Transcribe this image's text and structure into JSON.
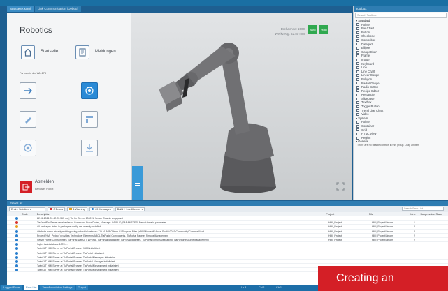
{
  "ide": {
    "doc_tabs": [
      "Startseite.xaml",
      "Link Communication (Debug)"
    ],
    "colors": {
      "accent": "#1e5f91",
      "brand_red": "#d41f26",
      "ok_green": "#2fa84f",
      "tile_blue": "#2a8ad6"
    }
  },
  "designer": {
    "app_title": "Robotics",
    "tiles": [
      {
        "icon": "home-icon",
        "label": "Startseite"
      },
      {
        "icon": "document-icon",
        "label": "Meldungen"
      }
    ],
    "section_label": "Formen in der WL-173",
    "button_icons": [
      "arrow-right-icon",
      "circle-target-icon",
      "pen-icon",
      "layout-icon",
      "radio-icon",
      "download-icon"
    ],
    "exit_tile": {
      "icon": "exit-icon",
      "label": "Abmelden",
      "sub": "Benutzer Robot"
    },
    "viewport": {
      "info_line1": "Drehachse: 1500",
      "info_line2": "Werkzeug: 32.50 mm",
      "btn_left": "Auto",
      "btn_right": "Hold"
    }
  },
  "toolbox": {
    "title": "Toolbox",
    "search_placeholder": "Search Toolbox",
    "groups": [
      {
        "name": "Standard",
        "items": [
          "Pointer",
          "Bar Chart",
          "Button",
          "Checkbox",
          "Combobox",
          "Datagrid",
          "Ellipse",
          "GaugeChart",
          "Frame",
          "Image",
          "Keyboard",
          "Line",
          "Line Chart",
          "Linear Gauge",
          "Polygon",
          "Radial Gauge",
          "Radio Button",
          "Recipe Editor",
          "Rectangle",
          "Slidebase",
          "Textbox",
          "Toggle Button",
          "Trend Line Chart",
          "Video"
        ]
      },
      {
        "name": "System",
        "items": [
          "Pointer",
          "Container",
          "Grid",
          "HTML View",
          "Region"
        ]
      },
      {
        "name": "General",
        "items": []
      }
    ],
    "footer": "There are no usable controls in this group. Drag an item"
  },
  "error_list": {
    "title": "Error List",
    "scope": "Entire Solution",
    "errors": "0 Errors",
    "warnings": "1 Warning",
    "messages": "69 Messages",
    "filter": "Build + IntelliSense",
    "search_placeholder": "Search Error List",
    "headers": [
      "",
      "Code",
      "Description",
      "Project",
      "File",
      "Line",
      "Suppression State"
    ],
    "rows": [
      {
        "sev": "info",
        "desc": "22.06.2021 09:42:20.353 ms | Tia Xe Server 100011: Server Cosmic angepasst",
        "project": "",
        "file": "",
        "line": ""
      },
      {
        "sev": "error",
        "desc": "TieFrontEndServer received error Command Error Codes, Message: INVALID_PARAMETER, Result: Invalid parameter",
        "project": "HMI_Project",
        "file": "HMI_ProjectSimons",
        "line": "1"
      },
      {
        "sev": "warn",
        "desc": "All packages listed in packages.config are already installed.",
        "project": "HMI_Project",
        "file": "HMI_ProjectSimons",
        "line": "2"
      },
      {
        "sev": "info",
        "desc": "Attribute name already existing using Industrial network: TIA M ROBO from CI Program Files (x86)\\Microsoft Visual Studio\\2019\\Community\\Common\\Mod",
        "project": "HMI_Project",
        "file": "HMI_ProjectSimons",
        "line": "2"
      },
      {
        "sev": "info",
        "desc": "Project 'HMI_Project' provides Technology Elements ABCL TiaPortal Components, TiaPortal Pakete, SimonsManagement",
        "project": "HMI_Project",
        "file": "HMI_ProjectSimons",
        "line": "2"
      },
      {
        "sev": "info",
        "desc": "Server Home Contraintrees TiaPortal WebUl [TiaPortal, TiaPortalDatatagger, TiaPortalDatatrees, TiaPortal SimonsMessaging, TiaPortalResourceManagement]",
        "project": "HMI_Project",
        "file": "HMI_ProjectSimons",
        "line": "2"
      },
      {
        "sev": "info",
        "desc": "Sql virtual database 100% ...",
        "project": "",
        "file": "",
        "line": ""
      },
      {
        "sev": "info",
        "desc": "TwinCAT HMI Server at TiaPortal Browser 1500 initialisiert",
        "project": "",
        "file": "",
        "line": ""
      },
      {
        "sev": "info",
        "desc": "TwinCAT HMI Server at TiaPortal Browser TiaPortal initialisiert",
        "project": "",
        "file": "",
        "line": ""
      },
      {
        "sev": "info",
        "desc": "TwinCAT HMI Server at TiaPortal Browser TiaPortalMessages initialisiert",
        "project": "",
        "file": "",
        "line": ""
      },
      {
        "sev": "info",
        "desc": "TwinCAT HMI Server at TiaPortal Browser TiaPortal Manager initialisiert",
        "project": "",
        "file": "",
        "line": ""
      },
      {
        "sev": "info",
        "desc": "TwinCAT HMI Server at TiaPortal Browser TiaPortalManagement initialisiert",
        "project": "",
        "file": "",
        "line": ""
      },
      {
        "sev": "info",
        "desc": "TwinCAT HMI Server at TiaPortal Browser TiaPortalManagement initialisiert",
        "project": "",
        "file": "",
        "line": ""
      }
    ]
  },
  "statusbar": {
    "tabs": [
      "Logged Errors",
      "Error List",
      "TeamFoundation Settings",
      "Output"
    ],
    "active_tab": 1,
    "right_items": [
      "Ln 4",
      "Col 1",
      "Ch 1"
    ]
  },
  "caption": "Creating an"
}
